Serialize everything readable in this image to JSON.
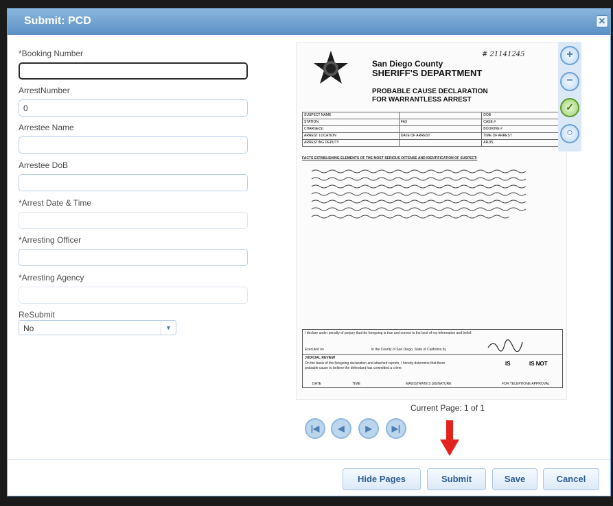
{
  "window": {
    "title": "Submit: PCD",
    "close_icon": "close-icon"
  },
  "form": {
    "booking_number": {
      "label": "*Booking Number",
      "value": ""
    },
    "arrest_number": {
      "label": "ArrestNumber",
      "value": "0"
    },
    "arrestee_name": {
      "label": "Arrestee Name",
      "value": ""
    },
    "arrestee_dob": {
      "label": "Arrestee DoB",
      "value": ""
    },
    "arrest_datetime": {
      "label": "*Arrest Date & Time",
      "value": ""
    },
    "arresting_officer": {
      "label": "*Arresting Officer",
      "value": ""
    },
    "arresting_agency": {
      "label": "*Arresting Agency",
      "value": ""
    },
    "resubmit": {
      "label": "ReSubmit",
      "value": "No"
    }
  },
  "document": {
    "case_no": "# 21141245",
    "org_line1": "San Diego County",
    "org_line2": "SHERIFF'S DEPARTMENT",
    "heading1": "PROBABLE CAUSE DECLARATION",
    "heading2": "FOR WARRANTLESS ARREST",
    "grid": [
      [
        "SUSPECT NAME",
        "",
        "DOB"
      ],
      [
        "STATION",
        "FAX",
        "CASE #"
      ],
      [
        "CHARGE(S)",
        "",
        "BOOKING #"
      ],
      [
        "ARREST LOCATION",
        "DATE OF ARREST",
        "TIME OF ARREST"
      ],
      [
        "ARRESTING DEPUTY",
        "",
        "ARJIS"
      ]
    ],
    "facts_header": "FACTS ESTABLISHING ELEMENTS OF THE MOST SERIOUS OFFENSE AND IDENTIFICATION OF SUSPECT:",
    "declaration": "I declare under penalty of perjury that the foregoing is true and correct to the best of my information and belief.",
    "executed_on": "Executed on",
    "county_state": "in the County of San Diego, State of California by",
    "judicial_review": "JUDICIAL REVIEW",
    "judicial_text": "On the basis of the foregoing declaration and attached reports, I hereby determine that there",
    "judicial_text2": "probable cause to believe the defendant has committed a crime.",
    "is_label": "IS",
    "is_not_label": "IS NOT",
    "sig_date": "DATE",
    "sig_time": "TIME",
    "sig_magistrate": "MAGISTRATE'S SIGNATURE",
    "sig_phone": "FOR TELEPHONE APPROVAL"
  },
  "zoom": {
    "icons": [
      "zoom-in-icon",
      "zoom-out-icon",
      "fit-check-icon",
      "zoom-reset-icon"
    ]
  },
  "pager": {
    "page_info": "Current Page: 1 of 1"
  },
  "footer": {
    "hide_pages": "Hide Pages",
    "submit": "Submit",
    "save": "Save",
    "cancel": "Cancel"
  },
  "colors": {
    "accent": "#5b90c4",
    "arrow": "#e3231b"
  }
}
